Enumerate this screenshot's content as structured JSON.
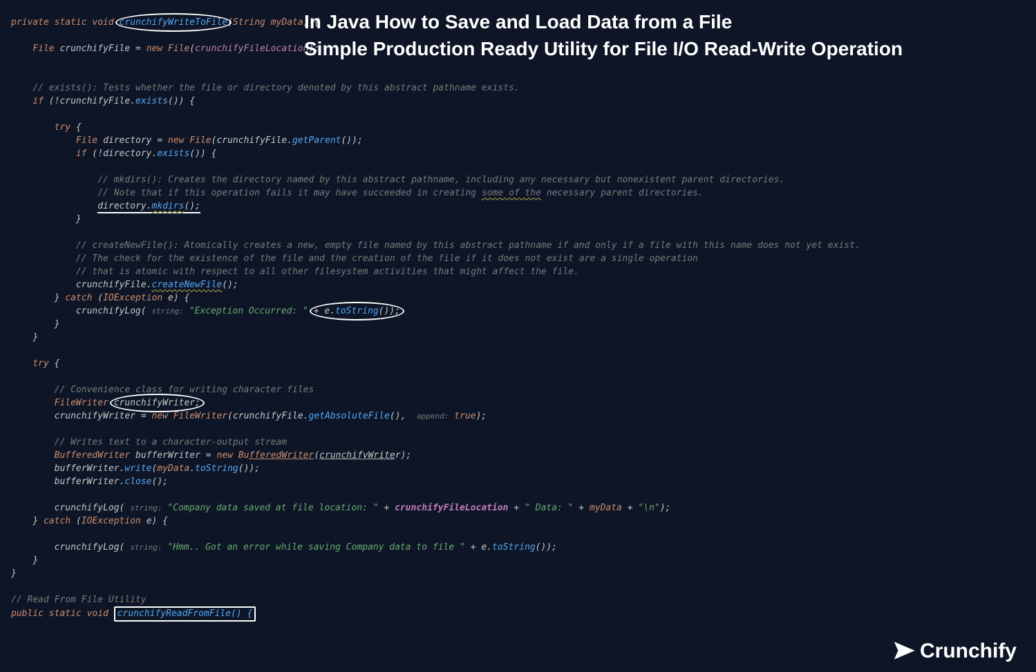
{
  "title": {
    "line1": "In Java How to Save and Load Data from a File",
    "line2": "Simple Production Ready Utility for File I/O Read-Write Operation"
  },
  "brand": "Crunchify",
  "code": {
    "sig": {
      "mods": "private static void",
      "name": "crunchifyWriteToFile",
      "ptype": "String",
      "pname": "myData"
    },
    "l2": {
      "type": "File",
      "var": "crunchifyFile",
      "new": "new",
      "ctor": "File",
      "arg": "crunchifyFileLocation"
    },
    "c_exists": "// exists(): Tests whether the file or directory denoted by this abstract pathname exists.",
    "if1": {
      "kw": "if",
      "neg": "!",
      "obj": "crunchifyFile",
      "call": "exists"
    },
    "try1": "try",
    "l_dir": {
      "type": "File",
      "var": "directory",
      "new": "new",
      "ctor": "File",
      "obj": "crunchifyFile",
      "call": "getParent"
    },
    "if2": {
      "kw": "if",
      "neg": "!",
      "obj": "directory",
      "call": "exists"
    },
    "c_mkdirs1": "// mkdirs(): Creates the directory named by this abstract pathname, including any necessary but nonexistent parent directories.",
    "c_mkdirs2a": "// Note that if this operation fails it may have succeeded in creating ",
    "c_mkdirs2_wavy": "some of the",
    "c_mkdirs2b": " necessary parent directories.",
    "mkdirs": {
      "obj": "directory",
      "call": "mkdirs"
    },
    "c_cnf1": "// createNewFile(): Atomically creates a new, empty file named by this abstract pathname if and only if a file with this name does not yet exist.",
    "c_cnf2": "// The check for the existence of the file and the creation of the file if it does not exist are a single operation",
    "c_cnf3": "// that is atomic with respect to all other filesystem activities that might affect the file.",
    "cnf": {
      "obj": "crunchifyFile",
      "call": "createNewFile"
    },
    "catch1": {
      "kw": "catch",
      "type": "IOException",
      "var": "e"
    },
    "log1": {
      "fn": "crunchifyLog",
      "hint": "string:",
      "str": "\"Exception Occurred: \"",
      "plus": "+",
      "e": "e",
      "call": "toString"
    },
    "try2": "try",
    "c_conv": "// Convenience class for writing character files",
    "fw_decl": {
      "type": "FileWriter",
      "var": "crunchifyWriter;"
    },
    "fw_asgn": {
      "var": "crunchifyWriter",
      "new": "new",
      "ctor": "FileWriter",
      "obj": "crunchifyFile",
      "call": "getAbsoluteFile",
      "hint": "append:",
      "val": "true"
    },
    "c_wrt": "// Writes text to a character-output stream",
    "bw_decl": {
      "type": "BufferedWriter",
      "var": "bufferWriter",
      "new": "new",
      "ctor": "Bu",
      "ctor_u": "fferedWriter",
      "arg": "crunchifyWrite",
      "arg_tail": "r"
    },
    "bw_write": {
      "obj": "bufferWriter",
      "call": "write",
      "arg": "myData",
      "call2": "toString"
    },
    "bw_close": {
      "obj": "bufferWriter",
      "call": "close"
    },
    "log2": {
      "fn": "crunchifyLog",
      "hint": "string:",
      "s1": "\"Company data saved at file location: \"",
      "f": "crunchifyFileLocation",
      "s2": "\" Data: \"",
      "m": "myData",
      "s3": "\"\\n\""
    },
    "catch2": {
      "kw": "catch",
      "type": "IOException",
      "var": "e"
    },
    "log3": {
      "fn": "crunchifyLog",
      "hint": "string:",
      "s1": "\"Hmm.. Got an error while saving Company data to file \"",
      "e": "e",
      "call": "toString"
    },
    "c_read": "// Read From File Utility",
    "sig2": {
      "mods": "public static void",
      "name": "crunchifyReadFromFile() {"
    }
  }
}
